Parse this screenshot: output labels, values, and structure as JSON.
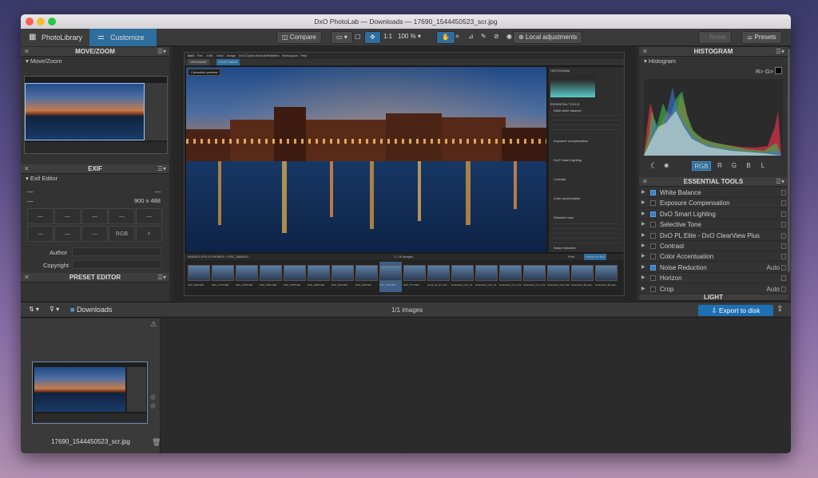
{
  "window": {
    "title": "DxO PhotoLab — Downloads — 17690_1544450523_scr.jpg"
  },
  "tabs": [
    {
      "label": "PhotoLibrary"
    },
    {
      "label": "Customize"
    }
  ],
  "toolbar": {
    "compare_label": "Compare",
    "ratio_label": "1:1",
    "zoom_label": "100 %",
    "local_adjustments_label": "Local adjustments",
    "reset_label": "Reset",
    "presets_label": "Presets"
  },
  "left_panel": {
    "move_zoom": {
      "header": "MOVE/ZOOM",
      "subtitle": "Move/Zoom"
    },
    "exif": {
      "header": "EXIF",
      "subtitle": "Exif Editor",
      "dash_left": "—",
      "dash_right": "—",
      "dash_small": "—",
      "dimensions": "900 x 488",
      "grid_row1": [
        "—",
        "—",
        "—",
        "—",
        "—"
      ],
      "grid_row2": [
        "—",
        "—",
        "—",
        "RGB",
        ""
      ],
      "author_label": "Author",
      "copyright_label": "Copyright"
    },
    "preset_editor": {
      "header": "PRESET EDITOR"
    }
  },
  "center": {
    "inner_menu": [
      "File",
      "Edit",
      "View",
      "Image",
      "DxO Optics Modules",
      "Palettes",
      "Workspace",
      "Help"
    ],
    "inner_tabs": [
      "ORGANIZE",
      "CUSTOMIZE"
    ],
    "correction_preview": "Correction preview",
    "inner_strip_path": "IMAGES ESS SCHEMES > DSC_0MEADI",
    "inner_count": "1 / 16 images",
    "inner_export": "Export to disk",
    "inner_print": "Print",
    "inner_palette_headers": [
      "HISTOGRAM",
      "ESSENTIAL TOOLS",
      "RAW white balance",
      "Exposure compensation",
      "DxO Smart Lighting",
      "Contrast",
      "Color accentuation",
      "Selective tone",
      "Noise reduction"
    ],
    "strip_labels": [
      "DSC_8A8.NEF",
      "DSC_2779.NEF",
      "DSC_2780.NEF",
      "DSC_2781.NEF",
      "DSC_2785.NEF",
      "DSC_2808.NEF",
      "DSC_0A4.NEF",
      "DSC_0A5.NEF",
      "DSC_0AE.NEF",
      "DSC_TT7.NEF",
      "Heron sd_pm_Inkl...",
      "Gubbenbo_Nuo_Gr...",
      "Gubbenbo_Nuo_Gr...",
      "Gubbenbo_Luro_Pan...",
      "Gubbenbo_Luro_Pan...",
      "Gubbenbo_Nuo_Pan...",
      "Gubbenbo_Bungen...",
      "Gubbenbo_Bungen..."
    ]
  },
  "right_panel": {
    "histogram": {
      "header": "HISTOGRAM",
      "subtitle": "Histogram",
      "channel_label": "R> G> B>",
      "channels": [
        "RGB",
        "R",
        "G",
        "B",
        "L"
      ]
    },
    "essential_tools": {
      "header": "ESSENTIAL TOOLS",
      "tools": [
        {
          "name": "White Balance",
          "value": "",
          "checked": true
        },
        {
          "name": "Exposure Compensation",
          "value": "",
          "checked": false
        },
        {
          "name": "DxO Smart Lighting",
          "value": "",
          "checked": true
        },
        {
          "name": "Selective Tone",
          "value": "",
          "checked": false
        },
        {
          "name": "DxO PL Elite - DxO ClearView Plus",
          "value": "",
          "checked": false
        },
        {
          "name": "Contrast",
          "value": "",
          "checked": false
        },
        {
          "name": "Color Accentuation",
          "value": "",
          "checked": false
        },
        {
          "name": "Noise Reduction",
          "value": "Auto",
          "checked": true
        },
        {
          "name": "Horizon",
          "value": "",
          "checked": false
        },
        {
          "name": "Crop",
          "value": "Auto",
          "checked": false
        }
      ],
      "next_header": "LIGHT"
    }
  },
  "bottom_bar": {
    "folder_label": "Downloads",
    "image_count": "1/1 images",
    "export_label": "Export to disk"
  },
  "browser": {
    "thumbnail_filename": "17690_1544450523_scr.jpg"
  },
  "colors": {
    "accent": "#1e6fb3",
    "tab_active": "#2d6e9e",
    "panel_bg": "#333333"
  }
}
